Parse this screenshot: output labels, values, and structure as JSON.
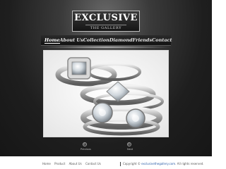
{
  "logo": {
    "title": "EXCLUSIVE",
    "subtitle": "THE GALLERY"
  },
  "nav": {
    "items": [
      {
        "label": "Home",
        "active": true
      },
      {
        "label": "About Us",
        "active": false
      },
      {
        "label": "Collection",
        "active": false
      },
      {
        "label": "Diamond",
        "active": false
      },
      {
        "label": "Friends",
        "active": false
      },
      {
        "label": "Contact",
        "active": false
      }
    ]
  },
  "slideshow": {
    "image": "diamond-rings-photo",
    "controls": [
      {
        "label": "Previous"
      },
      {
        "label": "Next"
      }
    ]
  },
  "footer": {
    "links": [
      "Home",
      "Product",
      "About Us",
      "Contact Us"
    ],
    "copyright_prefix": "Copyright ©",
    "copyright_link": "exclusivethegallery.com",
    "copyright_suffix": ". All rights reserved."
  },
  "colors": {
    "background": "#1e1e1e",
    "nav_text": "#e6e6e6",
    "footer_link": "#2a5da8"
  }
}
